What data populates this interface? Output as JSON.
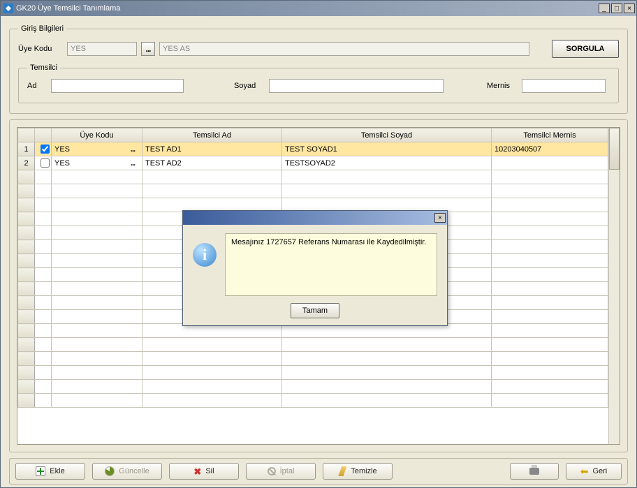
{
  "window": {
    "title": "GK20 Üye Temsilci Tanımlama"
  },
  "giris": {
    "legend": "Giriş Bilgileri",
    "uye_kodu_label": "Üye Kodu",
    "uye_kodu_value": "YES",
    "uye_adi_value": "YES AS",
    "sorgula_label": "SORGULA",
    "temsilci": {
      "legend": "Temsilci",
      "ad_label": "Ad",
      "ad_value": "",
      "soyad_label": "Soyad",
      "soyad_value": "",
      "mernis_label": "Mernis",
      "mernis_value": ""
    }
  },
  "grid": {
    "headers": {
      "uye_kodu": "Üye Kodu",
      "temsilci_ad": "Temsilci Ad",
      "temsilci_soyad": "Temsilci Soyad",
      "temsilci_mernis": "Temsilci Mernis"
    },
    "rows": [
      {
        "num": "1",
        "checked": true,
        "uye": "YES",
        "ad": "TEST AD1",
        "soyad": "TEST SOYAD1",
        "mernis": "10203040507"
      },
      {
        "num": "2",
        "checked": false,
        "uye": "YES",
        "ad": "TEST AD2",
        "soyad": "TESTSOYAD2",
        "mernis": ""
      }
    ]
  },
  "dialog": {
    "message": "Mesajınız 1727657 Referans Numarası ile Kaydedilmiştir.",
    "ok": "Tamam"
  },
  "toolbar": {
    "ekle": "Ekle",
    "guncelle": "Güncelle",
    "sil": "Sil",
    "iptal": "İptal",
    "temizle": "Temizle",
    "geri": "Geri"
  }
}
